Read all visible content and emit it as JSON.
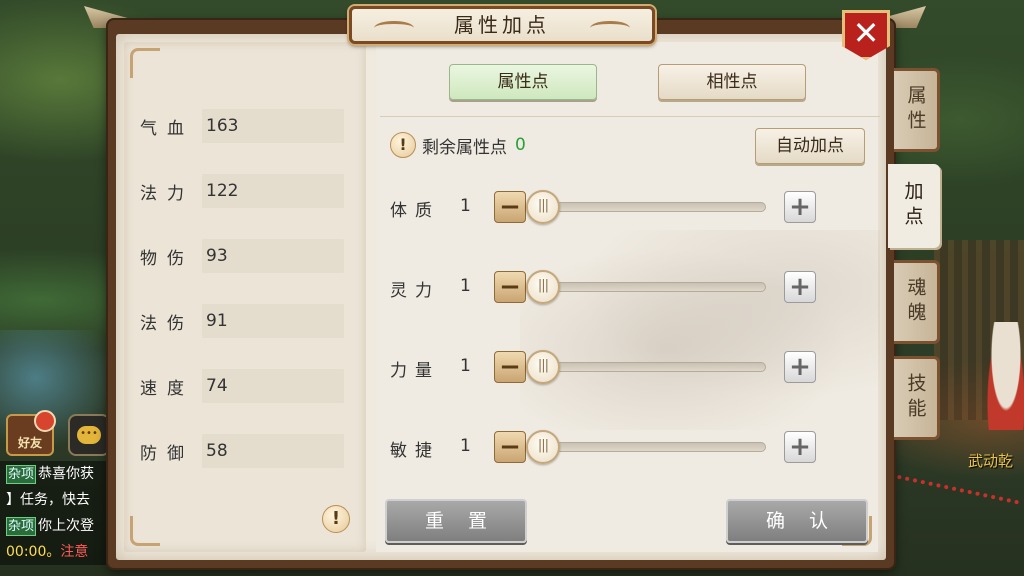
{
  "window": {
    "title": "属性加点"
  },
  "stats": [
    {
      "label": "气血",
      "value": "163"
    },
    {
      "label": "法力",
      "value": "122"
    },
    {
      "label": "物伤",
      "value": "93"
    },
    {
      "label": "法伤",
      "value": "91"
    },
    {
      "label": "速度",
      "value": "74"
    },
    {
      "label": "防御",
      "value": "58"
    }
  ],
  "tabs": [
    {
      "label": "属性点",
      "active": true
    },
    {
      "label": "相性点",
      "active": false
    }
  ],
  "remaining": {
    "label": "剩余属性点",
    "count": "0"
  },
  "auto_button": "自动加点",
  "attributes": [
    {
      "label": "体质",
      "value": "1"
    },
    {
      "label": "灵力",
      "value": "1"
    },
    {
      "label": "力量",
      "value": "1"
    },
    {
      "label": "敏捷",
      "value": "1"
    }
  ],
  "buttons": {
    "reset": "重置",
    "confirm": "确认"
  },
  "side_tabs": [
    {
      "label": "属性",
      "active": false
    },
    {
      "label": "加点",
      "active": true
    },
    {
      "label": "魂魄",
      "active": false
    },
    {
      "label": "技能",
      "active": false
    }
  ],
  "hud": {
    "friend_label": "好友",
    "chat_lines": [
      {
        "tag": "杂项",
        "text": "恭喜你获"
      },
      {
        "tag": "",
        "text": "】任务，快去"
      },
      {
        "tag": "杂项",
        "text": "你上次登"
      },
      {
        "time": "00:00。",
        "warn": "注意"
      }
    ],
    "npc_name": "武动乾"
  },
  "icons": {
    "close": "close-icon",
    "hint": "exclamation-icon",
    "minus": "minus-icon",
    "plus": "plus-icon",
    "thumb": "slider-grip-icon"
  },
  "colors": {
    "accent_green": "#28a03a",
    "close_red": "#b9221c",
    "frame_brown": "#5a3a22",
    "parchment": "#efe9de"
  }
}
